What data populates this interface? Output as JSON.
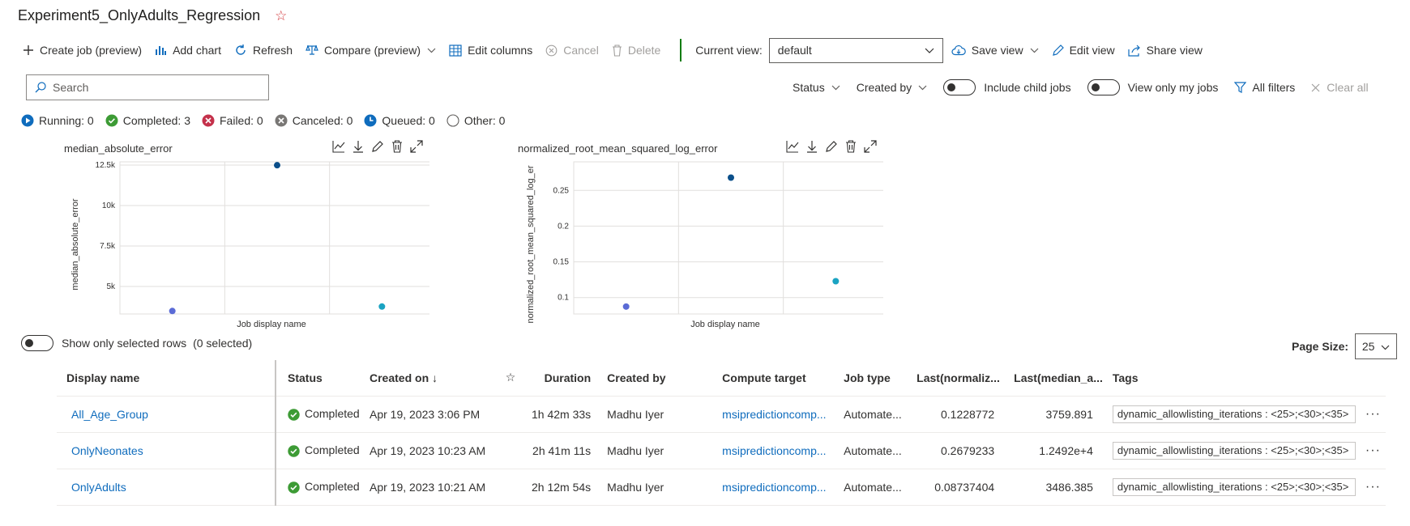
{
  "header": {
    "title": "Experiment5_OnlyAdults_Regression"
  },
  "toolbar": {
    "create_job": "Create job (preview)",
    "add_chart": "Add chart",
    "refresh": "Refresh",
    "compare": "Compare (preview)",
    "edit_columns": "Edit columns",
    "cancel": "Cancel",
    "delete": "Delete",
    "current_view_label": "Current view:",
    "current_view_value": "default",
    "save_view": "Save view",
    "edit_view": "Edit view",
    "share_view": "Share view"
  },
  "search": {
    "placeholder": "Search"
  },
  "filters": {
    "status": "Status",
    "created_by": "Created by",
    "include_child_jobs": "Include child jobs",
    "view_only_my_jobs": "View only my jobs",
    "all_filters": "All filters",
    "clear_all": "Clear all"
  },
  "status_counts": {
    "running": "Running: 0",
    "completed": "Completed: 3",
    "failed": "Failed: 0",
    "canceled": "Canceled: 0",
    "queued": "Queued: 0",
    "other": "Other: 0"
  },
  "colors": {
    "accent": "#0f6cbd",
    "point1": "#5b6bd6",
    "point2": "#0b4f8a",
    "point3": "#1aa3c2"
  },
  "chart_data": [
    {
      "type": "scatter",
      "title": "median_absolute_error",
      "ylabel": "median_absolute_error",
      "xlabel": "Job display name",
      "ylim": [
        3300,
        12700
      ],
      "yticks": [
        "5k",
        "7.5k",
        "10k",
        "12.5k"
      ],
      "ytick_values": [
        5000,
        7500,
        10000,
        12500
      ],
      "categories": [
        "OnlyAdults",
        "OnlyNeonates",
        "All_Age_Group"
      ],
      "values": [
        3486.385,
        12492,
        3759.891
      ],
      "grid": true
    },
    {
      "type": "scatter",
      "title": "normalized_root_mean_squared_log_error",
      "ylabel": "normalized_root_mean_squared_log_er",
      "xlabel": "Job display name",
      "ylim": [
        0.077,
        0.29
      ],
      "yticks": [
        "0.1",
        "0.15",
        "0.2",
        "0.25"
      ],
      "ytick_values": [
        0.1,
        0.15,
        0.2,
        0.25
      ],
      "categories": [
        "OnlyAdults",
        "OnlyNeonates",
        "All_Age_Group"
      ],
      "values": [
        0.08737404,
        0.2679233,
        0.1228772
      ],
      "grid": true
    }
  ],
  "selection": {
    "label": "Show only selected rows",
    "count": "(0 selected)"
  },
  "page_size": {
    "label": "Page Size:",
    "value": "25"
  },
  "table": {
    "headers": {
      "display_name": "Display name",
      "status": "Status",
      "created_on": "Created on",
      "duration": "Duration",
      "created_by": "Created by",
      "compute_target": "Compute target",
      "job_type": "Job type",
      "last_norm": "Last(normaliz...",
      "last_median": "Last(median_a...",
      "tags": "Tags"
    },
    "rows": [
      {
        "name": "All_Age_Group",
        "status": "Completed",
        "created_on": "Apr 19, 2023 3:06 PM",
        "duration": "1h 42m 33s",
        "created_by": "Madhu Iyer",
        "compute": "msipredictioncomp...",
        "job_type": "Automate...",
        "last_norm": "0.1228772",
        "last_median": "3759.891",
        "tags": "dynamic_allowlisting_iterations : <25>;<30>;<35>"
      },
      {
        "name": "OnlyNeonates",
        "status": "Completed",
        "created_on": "Apr 19, 2023 10:23 AM",
        "duration": "2h 41m 11s",
        "created_by": "Madhu Iyer",
        "compute": "msipredictioncomp...",
        "job_type": "Automate...",
        "last_norm": "0.2679233",
        "last_median": "1.2492e+4",
        "tags": "dynamic_allowlisting_iterations : <25>;<30>;<35>"
      },
      {
        "name": "OnlyAdults",
        "status": "Completed",
        "created_on": "Apr 19, 2023 10:21 AM",
        "duration": "2h 12m 54s",
        "created_by": "Madhu Iyer",
        "compute": "msipredictioncomp...",
        "job_type": "Automate...",
        "last_norm": "0.08737404",
        "last_median": "3486.385",
        "tags": "dynamic_allowlisting_iterations : <25>;<30>;<35>"
      }
    ]
  }
}
